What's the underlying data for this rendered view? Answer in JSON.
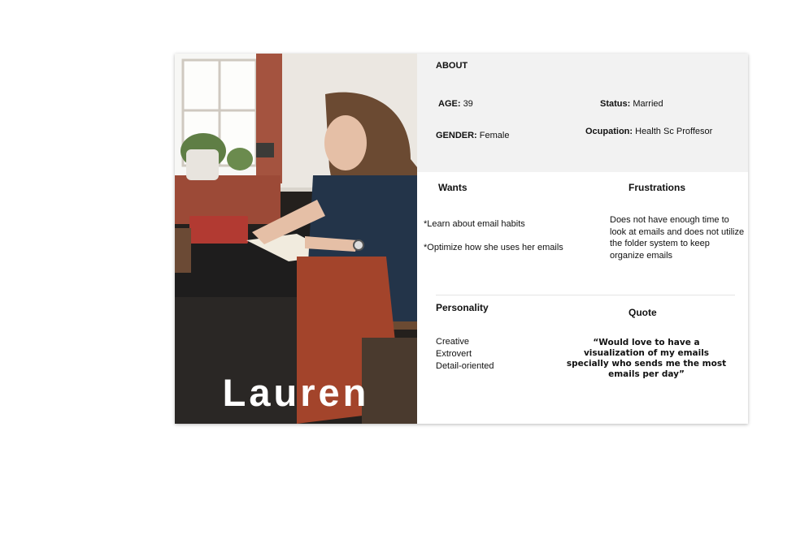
{
  "persona": {
    "name": "Lauren",
    "about_heading": "ABOUT",
    "age": {
      "label": "AGE:",
      "value": "39"
    },
    "status": {
      "label": "Status:",
      "value": "Married"
    },
    "gender": {
      "label": "GENDER:",
      "value": "Female"
    },
    "occupation": {
      "label": "Ocupation:",
      "value": "Health Sc Proffesor"
    },
    "wants": {
      "heading": "Wants",
      "items": [
        "*Learn about email habits",
        "*Optimize how she uses her emails"
      ]
    },
    "frustrations": {
      "heading": "Frustrations",
      "text": "Does not have enough time to look at emails and does not utilize the folder system to keep organize emails"
    },
    "personality": {
      "heading": "Personality",
      "traits": [
        "Creative",
        "Extrovert",
        "Detail-oriented"
      ]
    },
    "quote": {
      "heading": "Quote",
      "text": "“Would love to have a visualization of my emails specially who sends me the most emails per day”"
    }
  },
  "colors": {
    "about_bg": "#f2f2f2",
    "card_bg": "#ffffff",
    "divider": "#e4e4e4"
  }
}
